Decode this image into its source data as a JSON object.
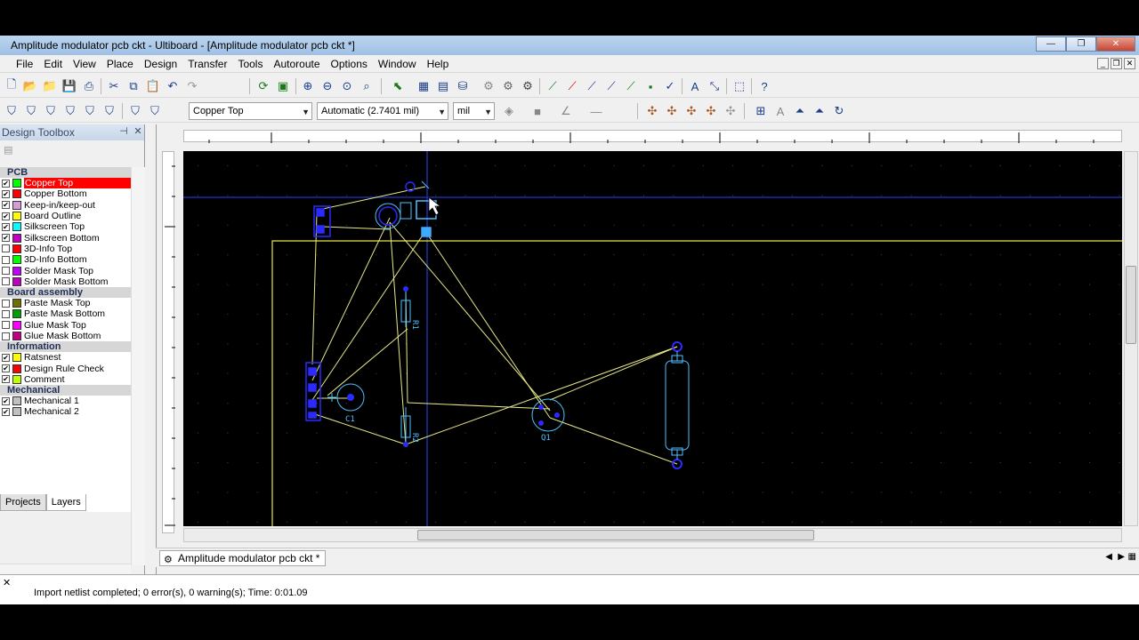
{
  "window": {
    "title": "Amplitude modulator pcb ckt - Ultiboard - [Amplitude modulator pcb ckt *]",
    "min": "—",
    "max": "❐",
    "close": "✕"
  },
  "menu": [
    "File",
    "Edit",
    "View",
    "Place",
    "Design",
    "Transfer",
    "Tools",
    "Autoroute",
    "Options",
    "Window",
    "Help"
  ],
  "toolbar": {
    "layer_combo": "Copper Top",
    "grid_combo": "Automatic (2.7401 mil)",
    "unit_combo": "mil"
  },
  "toolbox": {
    "title": "Design Toolbox",
    "groups": [
      {
        "name": "PCB",
        "items": [
          {
            "label": "Copper Top",
            "checked": true,
            "color": "#00ff00",
            "selected": true
          },
          {
            "label": "Copper Bottom",
            "checked": true,
            "color": "#ff0000"
          },
          {
            "label": "Keep-in/keep-out",
            "checked": true,
            "color": "#d89bd8"
          },
          {
            "label": "Board Outline",
            "checked": true,
            "color": "#ffff00"
          },
          {
            "label": "Silkscreen Top",
            "checked": true,
            "color": "#00ffff"
          },
          {
            "label": "Silkscreen Bottom",
            "checked": true,
            "color": "#c000c0"
          },
          {
            "label": "3D-Info Top",
            "checked": false,
            "color": "#ff0000"
          },
          {
            "label": "3D-Info Bottom",
            "checked": false,
            "color": "#00ff00"
          },
          {
            "label": "Solder Mask Top",
            "checked": false,
            "color": "#c000ff"
          },
          {
            "label": "Solder Mask Bottom",
            "checked": false,
            "color": "#c000c0"
          }
        ]
      },
      {
        "name": "Board assembly",
        "items": [
          {
            "label": "Paste Mask Top",
            "checked": false,
            "color": "#707000"
          },
          {
            "label": "Paste Mask Bottom",
            "checked": false,
            "color": "#00a000"
          },
          {
            "label": "Glue Mask Top",
            "checked": false,
            "color": "#ff00ff"
          },
          {
            "label": "Glue Mask Bottom",
            "checked": false,
            "color": "#c00080"
          }
        ]
      },
      {
        "name": "Information",
        "items": [
          {
            "label": "Ratsnest",
            "checked": true,
            "color": "#ffff00"
          },
          {
            "label": "Design Rule Check",
            "checked": true,
            "color": "#ff0000"
          },
          {
            "label": "Comment",
            "checked": true,
            "color": "#c0ff00"
          }
        ]
      },
      {
        "name": "Mechanical",
        "items": [
          {
            "label": "Mechanical 1",
            "checked": true,
            "color": "#c0c0c0"
          },
          {
            "label": "Mechanical 2",
            "checked": true,
            "color": "#c0c0c0"
          }
        ]
      }
    ],
    "tabs": [
      "Projects",
      "Layers"
    ]
  },
  "document_tab": "Amplitude modulator pcb ckt *",
  "labels": {
    "c1": "C1",
    "q1": "Q1",
    "r1": "R1",
    "r2": "R2"
  },
  "status": "Import netlist completed;  0 error(s), 0 warning(s);  Time: 0:01.09"
}
